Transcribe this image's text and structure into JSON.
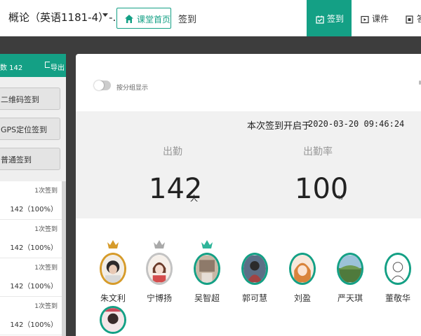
{
  "header": {
    "course_title": "概论（英语1181-4）-...",
    "home_button": "课堂首页",
    "breadcrumb": "签到",
    "tabs": [
      {
        "label": "签到",
        "icon": "calendar-check-icon",
        "active": true
      },
      {
        "label": "课件",
        "icon": "play-square-icon",
        "active": false
      },
      {
        "label": "答",
        "icon": "qa-icon",
        "active": false
      }
    ]
  },
  "left_panel": {
    "count_label": "数 142",
    "export_label": "导出",
    "methods": [
      "二维码签到",
      "GPS定位签到",
      "普通签到"
    ],
    "records": [
      {
        "times": "1次签到",
        "stat": "142（100%）"
      },
      {
        "times": "1次签到",
        "stat": "142（100%）"
      },
      {
        "times": "1次签到",
        "stat": "142（100%）"
      },
      {
        "times": "1次签到",
        "stat": "142（100%）"
      }
    ]
  },
  "main": {
    "toggle_label": "按分组显示",
    "start_label": "本次签到开启于",
    "start_time": "2020-03-20 09:46:24",
    "attendance_label": "出勤",
    "attendance_value": "142",
    "attendance_unit": "人",
    "rate_label": "出勤率",
    "rate_value": "100",
    "rate_unit": "%",
    "students": [
      {
        "name": "朱文利",
        "crown": "gold"
      },
      {
        "name": "宁博扬",
        "crown": "silver"
      },
      {
        "name": "吴智超",
        "crown": "teal"
      },
      {
        "name": "郭可慧",
        "crown": ""
      },
      {
        "name": "刘盈",
        "crown": ""
      },
      {
        "name": "严天琪",
        "crown": ""
      },
      {
        "name": "董敬华",
        "crown": ""
      }
    ]
  },
  "colors": {
    "accent": "#14a085",
    "gold": "#d69b2a",
    "silver": "#c3c3c3",
    "background": "#3d3d3d"
  }
}
